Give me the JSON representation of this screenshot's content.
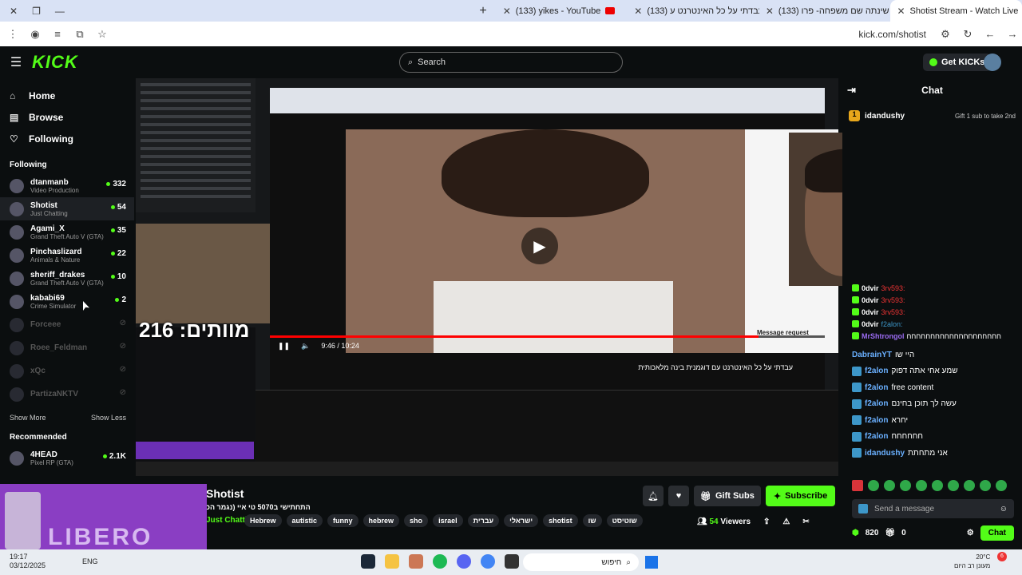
{
  "browser": {
    "tabs": [
      {
        "title": "(133) yikes - YouTube"
      },
      {
        "title": "(133) עבדתי על כל האינטרנט ע"
      },
      {
        "title": "(133) שינתה שם משפחה- פרו"
      },
      {
        "title": "Shotist Stream - Watch Live",
        "active": true
      }
    ],
    "url": "kick.com/shotist"
  },
  "header": {
    "search_placeholder": "Search",
    "get_kicks": "Get KICKs",
    "logo": "KICK"
  },
  "sidebar": {
    "nav": [
      {
        "label": "Home"
      },
      {
        "label": "Browse"
      },
      {
        "label": "Following"
      }
    ],
    "following_title": "Following",
    "following": [
      {
        "name": "dtanmanb",
        "game": "Video Production",
        "viewers": "332"
      },
      {
        "name": "Shotist",
        "game": "Just Chatting",
        "viewers": "54"
      },
      {
        "name": "Agami_X",
        "game": "Grand Theft Auto V (GTA)",
        "viewers": "35"
      },
      {
        "name": "Pinchaslizard",
        "game": "Animals & Nature",
        "viewers": "22"
      },
      {
        "name": "sheriff_drakes",
        "game": "Grand Theft Auto V (GTA)",
        "viewers": "10"
      },
      {
        "name": "kababi69",
        "game": "Crime Simulator",
        "viewers": "2"
      }
    ],
    "offline": [
      {
        "name": "Forceee"
      },
      {
        "name": "Roee_Feldman"
      },
      {
        "name": "xQc"
      },
      {
        "name": "PartizaNKTV"
      }
    ],
    "show_more": "Show More",
    "show_less": "Show Less",
    "recommended_title": "Recommended",
    "recommended": [
      {
        "name": "4HEAD",
        "game": "Pixel RP (GTA)",
        "viewers": "2.1K"
      }
    ]
  },
  "video": {
    "deaths_text": "מוותים: 216",
    "youtube_time": "9:46 / 10:24",
    "message_request": "Message request",
    "youtube_title": "עבדתי על כל האינטרנט עם דוגמנית בינה מלאכותית",
    "progress": 0.88
  },
  "stream": {
    "channel": "Shotist",
    "title": "התחתישי ב5070 טי איי (נגמר הכ",
    "category": "Just Chatting",
    "tags": [
      "Hebrew",
      "autistic",
      "funny",
      "hebrew",
      "sho",
      "israel",
      "עברית",
      "ישראלי",
      "shotist",
      "שו",
      "שוטיסט"
    ],
    "gift_subs": "Gift Subs",
    "subscribe": "Subscribe",
    "viewers": "54",
    "viewers_label": "Viewers"
  },
  "chat": {
    "title": "Chat",
    "pinned_user": "idandushy",
    "pinned_badge": "1",
    "gift_text": "Gift 1 sub to take 2nd",
    "messages": [
      {
        "user": "0dvir",
        "text": "3rv593:"
      },
      {
        "user": "0dvir",
        "text": "3rv593:"
      },
      {
        "user": "0dvir",
        "text": "3rv593:"
      },
      {
        "user": "0dvir",
        "text": "f2alon:"
      },
      {
        "user": "MrShtrongol",
        "text": "חחחחחחחחחחחחחחחחחחחח"
      }
    ],
    "messages2": [
      {
        "user": "DabrainYT",
        "text": "היי שו"
      },
      {
        "user": "f2alon",
        "text": "שמע אחי אתה דפוק"
      },
      {
        "user": "f2alon",
        "text": "free content"
      },
      {
        "user": "f2alon",
        "text": "עשה לך תוכן בחינם"
      },
      {
        "user": "f2alon",
        "text": "יחרא"
      },
      {
        "user": "f2alon",
        "text": "חחחחחח"
      },
      {
        "user": "idandushy",
        "text": "אני מתחתת"
      }
    ],
    "send_placeholder": "Send a message",
    "kicks_count": "820",
    "gifts_count": "0",
    "chat_button": "Chat"
  },
  "taskbar": {
    "time": "19:17",
    "date": "03/12/2025",
    "lang": "ENG",
    "search": "חיפוש",
    "temp": "20°C",
    "weather": "מעונן רב היום",
    "notif": "6"
  },
  "colors": {
    "accent": "#53fc18",
    "bg": "#0b0e0f"
  }
}
